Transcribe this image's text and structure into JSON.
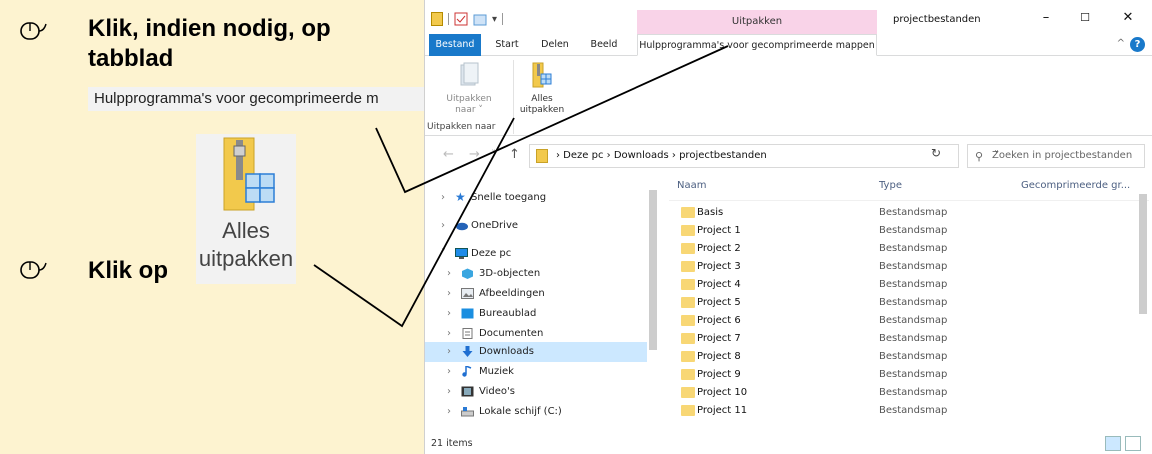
{
  "left_panel": {
    "step1_text": "Klik, indien nodig, op tabblad",
    "step1_callout": "Hulpprogramma's voor gecomprimeerde m",
    "step2_text": "Klik op",
    "button_label_line1": "Alles",
    "button_label_line2": "uitpakken"
  },
  "window": {
    "context_tab": "Uitpakken",
    "title": "projectbestanden",
    "controls": {
      "minimize": "–",
      "maximize": "☐",
      "close": "✕"
    },
    "tabs": [
      "Bestand",
      "Start",
      "Delen",
      "Beeld",
      "Hulpprogramma's voor gecomprimeerde mappen"
    ],
    "help": "?",
    "ribbon_collapse": "^",
    "ribbon": {
      "btn_uitpakken_naar_line1": "Uitpakken",
      "btn_uitpakken_naar_line2": "naar ˅",
      "btn_alles_line1": "Alles",
      "btn_alles_line2": "uitpakken",
      "group_label": "Uitpakken naar"
    },
    "address": {
      "back": "←",
      "forward": "→",
      "recent": "˅",
      "up": "↑",
      "path": "›  Deze pc  ›  Downloads  ›  projectbestanden",
      "dropdown": "˅",
      "refresh": "↻",
      "search_icon": "⚲",
      "search_placeholder": "Zoeken in projectbestanden"
    },
    "nav": [
      {
        "label": "Snelle toegang",
        "chev": "›",
        "icon": "star-icon"
      },
      {
        "label": "OneDrive",
        "chev": "›",
        "icon": "cloud-icon"
      },
      {
        "label": "Deze pc",
        "chev": "˅",
        "icon": "computer-icon"
      },
      {
        "label": "3D-objecten",
        "chev": "›",
        "icon": "cube-icon"
      },
      {
        "label": "Afbeeldingen",
        "chev": "›",
        "icon": "pictures-icon"
      },
      {
        "label": "Bureaublad",
        "chev": "›",
        "icon": "desktop-icon"
      },
      {
        "label": "Documenten",
        "chev": "›",
        "icon": "documents-icon"
      },
      {
        "label": "Downloads",
        "chev": "›",
        "icon": "download-icon"
      },
      {
        "label": "Muziek",
        "chev": "›",
        "icon": "music-icon"
      },
      {
        "label": "Video's",
        "chev": "›",
        "icon": "video-icon"
      },
      {
        "label": "Lokale schijf (C:)",
        "chev": "›",
        "icon": "drive-icon"
      }
    ],
    "columns": {
      "name": "Naam",
      "type": "Type",
      "size": "Gecomprimeerde gr..."
    },
    "files": [
      {
        "name": "Basis",
        "type": "Bestandsmap"
      },
      {
        "name": "Project 1",
        "type": "Bestandsmap"
      },
      {
        "name": "Project 2",
        "type": "Bestandsmap"
      },
      {
        "name": "Project 3",
        "type": "Bestandsmap"
      },
      {
        "name": "Project 4",
        "type": "Bestandsmap"
      },
      {
        "name": "Project 5",
        "type": "Bestandsmap"
      },
      {
        "name": "Project 6",
        "type": "Bestandsmap"
      },
      {
        "name": "Project 7",
        "type": "Bestandsmap"
      },
      {
        "name": "Project 8",
        "type": "Bestandsmap"
      },
      {
        "name": "Project 9",
        "type": "Bestandsmap"
      },
      {
        "name": "Project 10",
        "type": "Bestandsmap"
      },
      {
        "name": "Project 11",
        "type": "Bestandsmap"
      }
    ],
    "status": "21 items"
  },
  "colors": {
    "panel_bg": "#fdf3d0",
    "file_tab": "#1979ca",
    "context_tab": "#f9d3e8",
    "selected": "#cce8ff",
    "folder": "#f8d775"
  }
}
